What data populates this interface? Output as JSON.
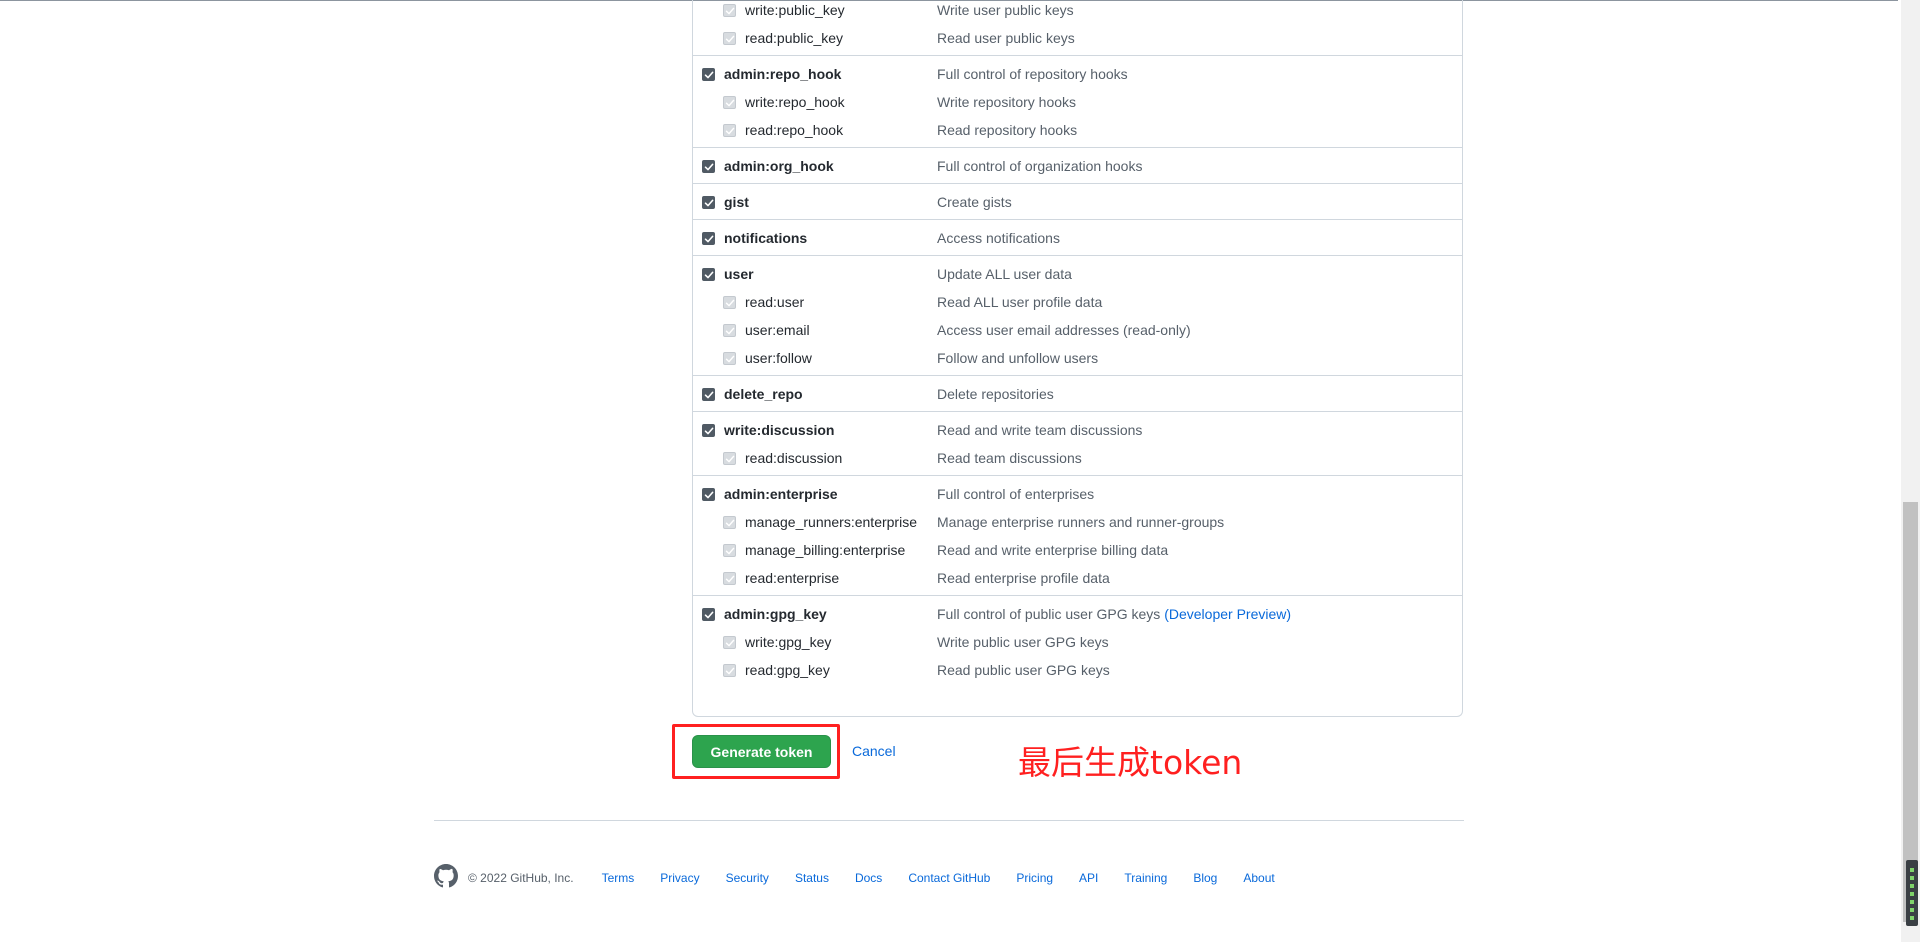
{
  "scope_groups": [
    {
      "items": [
        {
          "name": "write:public_key",
          "desc": "Write user public keys",
          "level": "child"
        },
        {
          "name": "read:public_key",
          "desc": "Read user public keys",
          "level": "child"
        }
      ]
    },
    {
      "items": [
        {
          "name": "admin:repo_hook",
          "desc": "Full control of repository hooks",
          "level": "parent"
        },
        {
          "name": "write:repo_hook",
          "desc": "Write repository hooks",
          "level": "child"
        },
        {
          "name": "read:repo_hook",
          "desc": "Read repository hooks",
          "level": "child"
        }
      ]
    },
    {
      "items": [
        {
          "name": "admin:org_hook",
          "desc": "Full control of organization hooks",
          "level": "parent"
        }
      ]
    },
    {
      "items": [
        {
          "name": "gist",
          "desc": "Create gists",
          "level": "parent"
        }
      ]
    },
    {
      "items": [
        {
          "name": "notifications",
          "desc": "Access notifications",
          "level": "parent"
        }
      ]
    },
    {
      "items": [
        {
          "name": "user",
          "desc": "Update ALL user data",
          "level": "parent"
        },
        {
          "name": "read:user",
          "desc": "Read ALL user profile data",
          "level": "child"
        },
        {
          "name": "user:email",
          "desc": "Access user email addresses (read-only)",
          "level": "child"
        },
        {
          "name": "user:follow",
          "desc": "Follow and unfollow users",
          "level": "child"
        }
      ]
    },
    {
      "items": [
        {
          "name": "delete_repo",
          "desc": "Delete repositories",
          "level": "parent"
        }
      ]
    },
    {
      "items": [
        {
          "name": "write:discussion",
          "desc": "Read and write team discussions",
          "level": "parent"
        },
        {
          "name": "read:discussion",
          "desc": "Read team discussions",
          "level": "child"
        }
      ]
    },
    {
      "items": [
        {
          "name": "admin:enterprise",
          "desc": "Full control of enterprises",
          "level": "parent"
        },
        {
          "name": "manage_runners:enterprise",
          "desc": "Manage enterprise runners and runner-groups",
          "level": "child"
        },
        {
          "name": "manage_billing:enterprise",
          "desc": "Read and write enterprise billing data",
          "level": "child"
        },
        {
          "name": "read:enterprise",
          "desc": "Read enterprise profile data",
          "level": "child"
        }
      ]
    },
    {
      "items": [
        {
          "name": "admin:gpg_key",
          "desc": "Full control of public user GPG keys",
          "link": "(Developer Preview)",
          "level": "parent"
        },
        {
          "name": "write:gpg_key",
          "desc": "Write public user GPG keys",
          "level": "child"
        },
        {
          "name": "read:gpg_key",
          "desc": "Read public user GPG keys",
          "level": "child"
        }
      ]
    }
  ],
  "actions": {
    "generate_label": "Generate token",
    "cancel_label": "Cancel"
  },
  "annotation": "最后生成token",
  "footer": {
    "copyright": "© 2022 GitHub, Inc.",
    "links": [
      "Terms",
      "Privacy",
      "Security",
      "Status",
      "Docs",
      "Contact GitHub",
      "Pricing",
      "API",
      "Training",
      "Blog",
      "About"
    ]
  },
  "colors": {
    "primary_button": "#2da44e",
    "link": "#0969da",
    "annotation": "#ff2020"
  }
}
